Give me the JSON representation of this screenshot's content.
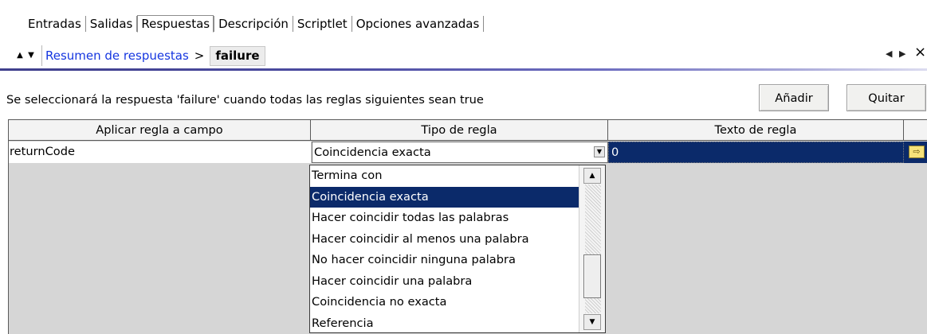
{
  "tabs": [
    {
      "label": "Entradas"
    },
    {
      "label": "Salidas"
    },
    {
      "label": "Respuestas"
    },
    {
      "label": "Descripción"
    },
    {
      "label": "Scriptlet"
    },
    {
      "label": "Opciones avanzadas"
    }
  ],
  "active_tab": "Respuestas",
  "breadcrumb": {
    "up_icon": "triangle-up-icon",
    "down_icon": "triangle-down-icon",
    "link": "Resumen de respuestas",
    "separator": ">",
    "current": "failure",
    "prev_icon": "triangle-left-icon",
    "next_icon": "triangle-right-icon",
    "close_icon": "close-icon",
    "close_glyph": "×"
  },
  "description": "Se seleccionará la respuesta 'failure' cuando todas las reglas siguientes sean true",
  "buttons": {
    "add": "Añadir",
    "remove": "Quitar"
  },
  "table": {
    "headers": [
      "Aplicar regla a campo",
      "Tipo de regla",
      "Texto de regla"
    ],
    "row": {
      "field": "returnCode",
      "rule_type": "Coincidencia exacta",
      "rule_text": "0",
      "edit_icon": "pencil-arrow-icon"
    }
  },
  "dropdown": {
    "options": [
      "Termina con",
      "Coincidencia exacta",
      "Hacer coincidir todas las palabras",
      "Hacer coincidir al menos una palabra",
      "No hacer coincidir ninguna palabra",
      "Hacer coincidir una palabra",
      "Coincidencia no exacta",
      "Referencia"
    ],
    "selected": "Coincidencia exacta"
  },
  "colors": {
    "selection": "#0b2a6a",
    "link": "#1536e0",
    "header_bg": "#f3f3f3"
  }
}
